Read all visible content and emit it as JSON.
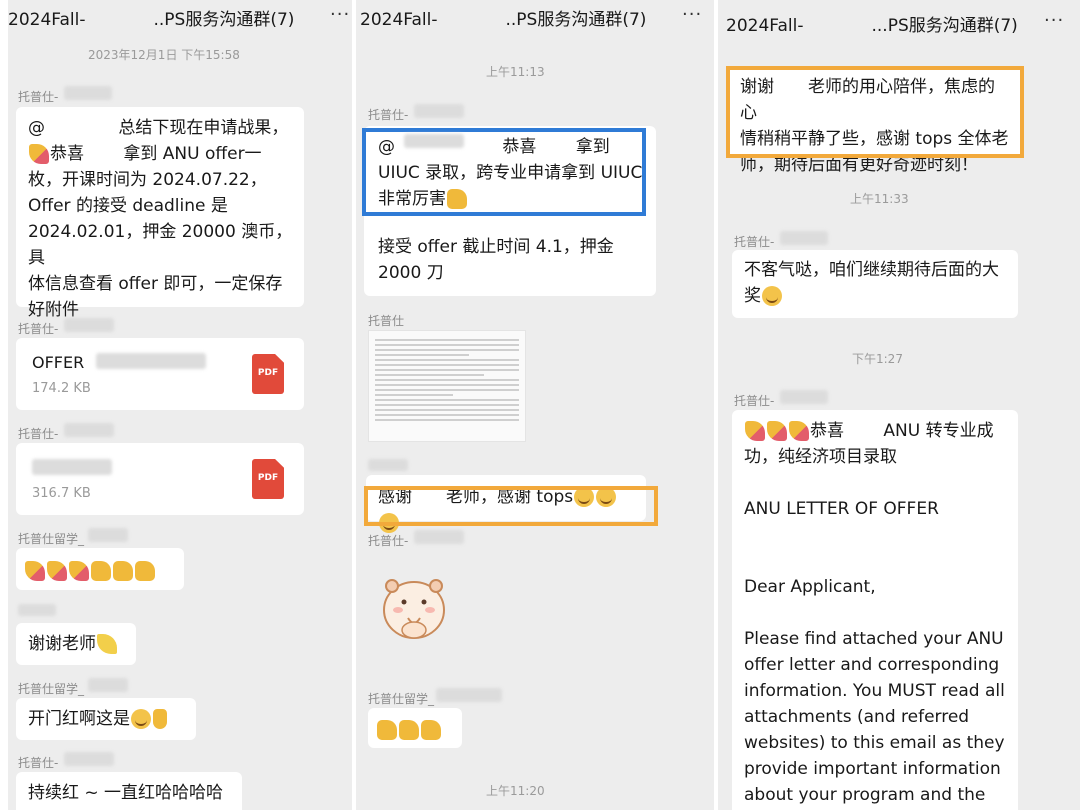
{
  "panels": [
    {
      "header": {
        "title": "2024Fall-    ..PS服务沟通群(7)",
        "more": "···"
      },
      "timestamp": "2023年12月1日 下午15:58",
      "messages": [
        {
          "sender": "托普仕-",
          "text_lines": [
            "@     总结下现在申请战果，",
            "恭喜   拿到 ANU offer一",
            "枚，开课时间为 2024.07.22，",
            "Offer 的接受 deadline 是",
            "2024.02.01，押金 20000 澳币，具",
            "体信息查看 offer 即可，一定保存",
            "好附件"
          ]
        },
        {
          "sender": "托普仕-",
          "file_name": "OFFER",
          "file_size": "174.2 KB",
          "file_icon": "PDF"
        },
        {
          "sender": "托普仕-",
          "file_name": "",
          "file_size": "316.7 KB",
          "file_icon": "PDF"
        },
        {
          "sender": "托普仕留学_",
          "emoji": [
            "party",
            "party",
            "party",
            "thumb",
            "thumb",
            "thumb"
          ]
        },
        {
          "sender": "",
          "text": "谢谢老师"
        },
        {
          "sender": "托普仕留学_",
          "text": "开门红啊这是"
        },
        {
          "sender": "托普仕-",
          "text": "持续红 ~ 一直红哈哈哈哈"
        }
      ]
    },
    {
      "header": {
        "title": "2024Fall-    ..PS服务沟通群(7)",
        "more": "···"
      },
      "timestamp_top": "上午11:13",
      "timestamp_bottom": "上午11:20",
      "messages": [
        {
          "sender": "托普仕-",
          "text_lines": [
            "@       恭喜   拿到",
            "UIUC 录取，跨专业申请拿到 UIUC",
            "非常厉害"
          ],
          "text2_lines": [
            "接受 offer 截止时间 4.1，押金",
            "2000 刀"
          ]
        },
        {
          "sender": "托普仕",
          "attachment": "document-image"
        },
        {
          "sender": "",
          "text": "感谢  老师，感谢 tops"
        },
        {
          "sender": "托普仕-",
          "sticker": "hamster"
        },
        {
          "sender": "托普仕留学_",
          "emoji": [
            "thumb",
            "thumb",
            "thumb"
          ]
        }
      ]
    },
    {
      "header": {
        "title": "2024Fall-    ...PS服务沟通群(7)",
        "more": "···"
      },
      "timestamp_1": "上午11:33",
      "timestamp_2": "下午1:27",
      "messages": [
        {
          "text_lines": [
            "谢谢  老师的用心陪伴，焦虑的心",
            "情稍稍平静了些，感谢 tops 全体老",
            "师，期待后面有更好奇迹时刻！"
          ]
        },
        {
          "sender": "托普仕-",
          "text_lines": [
            "不客气哒，咱们继续期待后面的大",
            "奖"
          ]
        },
        {
          "sender": "托普仕-",
          "text_lines": [
            "恭喜   ANU 转专业成",
            "功，纯经济项目录取",
            "",
            "ANU LETTER OF OFFER",
            "",
            "",
            "Dear Applicant,",
            "",
            "Please find attached your ANU",
            "offer letter and corresponding",
            "information. You MUST read all",
            "attachments (and referred",
            "websites) to this email as they",
            "provide important information",
            "about your program and the"
          ]
        }
      ]
    }
  ]
}
